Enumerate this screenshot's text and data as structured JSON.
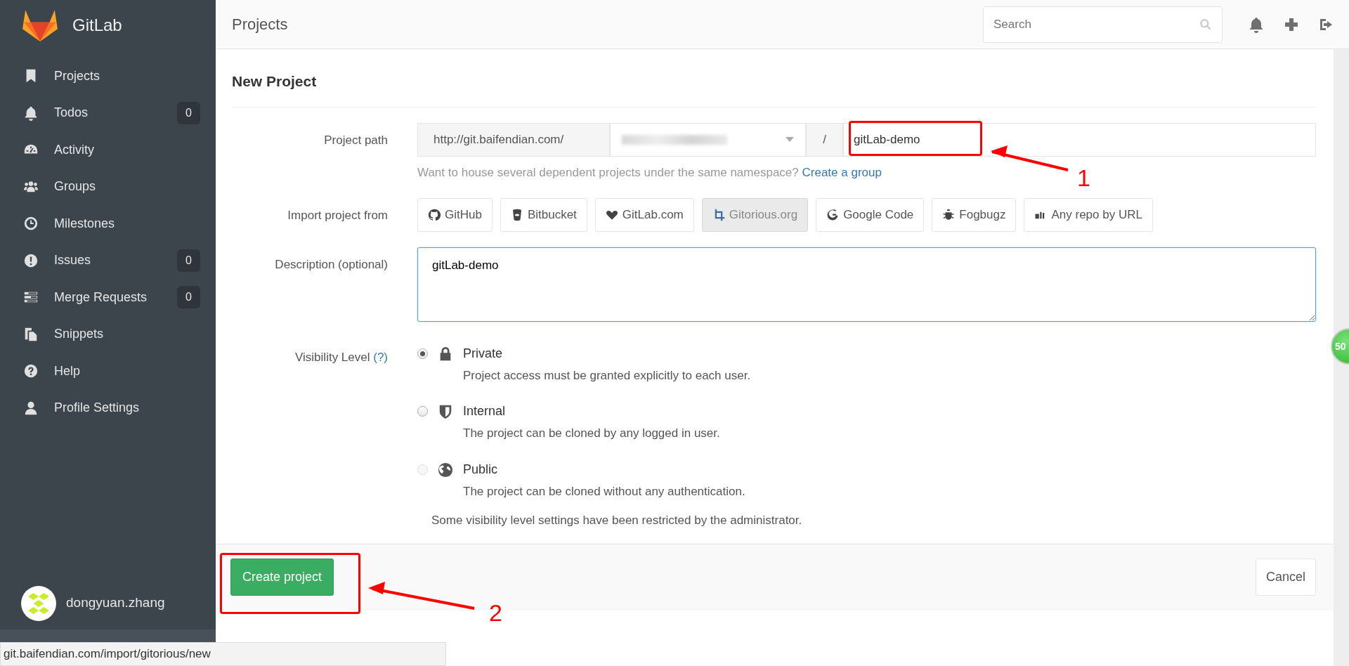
{
  "brand": {
    "name": "GitLab"
  },
  "sidebar": {
    "items": [
      {
        "label": "Projects"
      },
      {
        "label": "Todos",
        "count": "0"
      },
      {
        "label": "Activity"
      },
      {
        "label": "Groups"
      },
      {
        "label": "Milestones"
      },
      {
        "label": "Issues",
        "count": "0"
      },
      {
        "label": "Merge Requests",
        "count": "0"
      },
      {
        "label": "Snippets"
      },
      {
        "label": "Help"
      },
      {
        "label": "Profile Settings"
      }
    ],
    "user": {
      "name": "dongyuan.zhang"
    }
  },
  "header": {
    "title": "Projects",
    "search": {
      "placeholder": "Search"
    }
  },
  "form": {
    "title": "New Project",
    "project_path": {
      "label": "Project path",
      "prefix": "http://git.baifendian.com/",
      "separator": "/",
      "value": "gitLab-demo",
      "hint": "Want to house several dependent projects under the same namespace?",
      "hint_link": "Create a group"
    },
    "import": {
      "label": "Import project from",
      "sources": [
        {
          "label": "GitHub",
          "selected": false
        },
        {
          "label": "Bitbucket",
          "selected": false
        },
        {
          "label": "GitLab.com",
          "selected": false
        },
        {
          "label": "Gitorious.org",
          "selected": true
        },
        {
          "label": "Google Code",
          "selected": false
        },
        {
          "label": "Fogbugz",
          "selected": false
        },
        {
          "label": "Any repo by URL",
          "selected": false
        }
      ]
    },
    "description": {
      "label": "Description (optional)",
      "value": "gitLab-demo"
    },
    "visibility": {
      "label": "Visibility Level",
      "help": "(?)",
      "options": [
        {
          "label": "Private",
          "text": "Project access must be granted explicitly to each user.",
          "checked": true,
          "disabled": false
        },
        {
          "label": "Internal",
          "text": "The project can be cloned by any logged in user.",
          "checked": false,
          "disabled": false
        },
        {
          "label": "Public",
          "text": "The project can be cloned without any authentication.",
          "checked": false,
          "disabled": true
        }
      ],
      "note": "Some visibility level settings have been restricted by the administrator."
    },
    "actions": {
      "submit": "Create project",
      "cancel": "Cancel"
    }
  },
  "floating_badge": "50",
  "status_url": "git.baifendian.com/import/gitorious/new",
  "annotations": [
    {
      "label": "1"
    },
    {
      "label": "2"
    }
  ]
}
